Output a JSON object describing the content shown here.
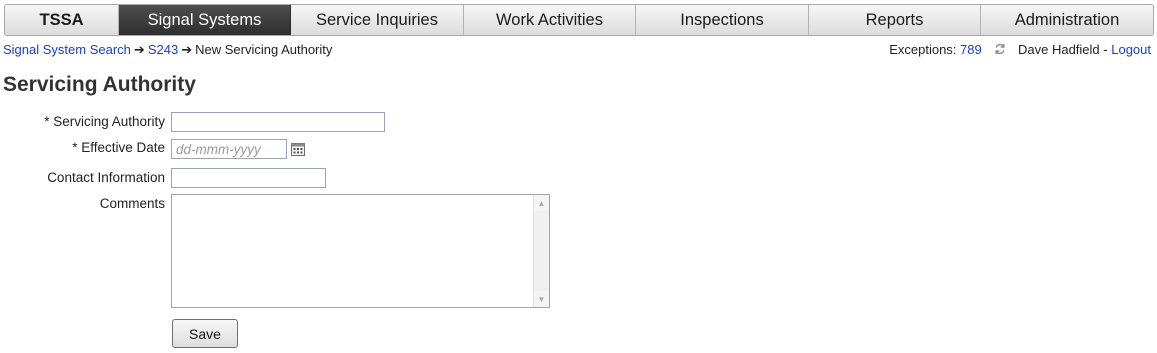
{
  "nav": {
    "brand": "TSSA",
    "tabs": [
      {
        "label": "Signal Systems"
      },
      {
        "label": "Service Inquiries"
      },
      {
        "label": "Work Activities"
      },
      {
        "label": "Inspections"
      },
      {
        "label": "Reports"
      },
      {
        "label": "Administration"
      }
    ],
    "active_tab": "Signal Systems"
  },
  "breadcrumb": {
    "items": [
      "Signal System Search",
      "S243"
    ],
    "current": "New Servicing Authority",
    "separator": "➔"
  },
  "userbar": {
    "exceptions_label": "Exceptions:",
    "exceptions_count": "789",
    "user_name": "Dave Hadfield",
    "separator": "-",
    "logout_label": "Logout"
  },
  "page": {
    "title": "Servicing Authority"
  },
  "form": {
    "servicing_authority": {
      "label": "* Servicing Authority",
      "value": ""
    },
    "effective_date": {
      "label": "* Effective Date",
      "value": "",
      "placeholder": "dd-mmm-yyyy"
    },
    "contact_information": {
      "label": "Contact Information",
      "value": ""
    },
    "comments": {
      "label": "Comments",
      "value": ""
    },
    "save_label": "Save"
  },
  "icons": {
    "calendar": "calendar-icon",
    "refresh": "refresh-icon"
  },
  "colors": {
    "link": "#1a3fbf",
    "nav_active_bg": "#3a3a3a",
    "nav_bg": "#e8e8e8"
  }
}
